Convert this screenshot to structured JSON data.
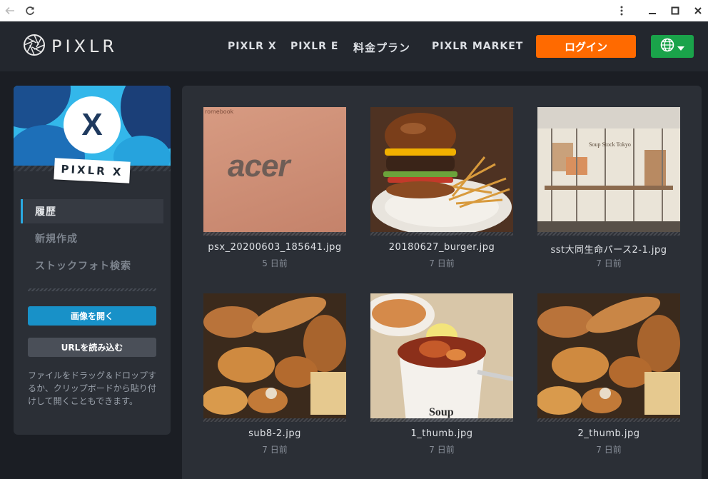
{
  "browser": {
    "back_icon": "arrow-left-icon",
    "reload_icon": "reload-icon",
    "menu_icon": "kebab-menu-icon",
    "minimize_icon": "minimize-icon",
    "maximize_icon": "maximize-icon",
    "close_icon": "close-icon"
  },
  "header": {
    "logo_text": "PIXLR",
    "nav": [
      "PIXLR X",
      "PIXLR E",
      "料金プラン",
      "PIXLR MARKET"
    ],
    "login_label": "ログイン",
    "language_icon": "globe-icon",
    "colors": {
      "login": "#ff6a00",
      "language": "#1aa34a",
      "bar": "#23272e"
    }
  },
  "sidebar": {
    "hero_letter": "X",
    "hero_tag": "PIXLR X",
    "items": [
      {
        "label": "履歴",
        "active": true
      },
      {
        "label": "新規作成",
        "active": false
      },
      {
        "label": "ストックフォト検索",
        "active": false
      }
    ],
    "open_image_label": "画像を開く",
    "load_url_label": "URLを読み込む",
    "help_text": "ファイルをドラッグ＆ドロップするか、クリップボードから貼り付けして開くこともできます。",
    "colors": {
      "accent": "#2aa9e0",
      "primary_button": "#1891c8"
    }
  },
  "gallery": {
    "items": [
      {
        "filename": "psx_20200603_185641.jpg",
        "age": "5 日前",
        "thumb_text": "acer",
        "thumb_caption": "romebook"
      },
      {
        "filename": "20180627_burger.jpg",
        "age": "7 日前"
      },
      {
        "filename": "sst大同生命パース2-1.jpg",
        "age": "7 日前",
        "thumb_text": "Soup Stock Tokyo"
      },
      {
        "filename": "sub8-2.jpg",
        "age": "7 日前"
      },
      {
        "filename": "1_thumb.jpg",
        "age": "7 日前",
        "thumb_text": "Soup"
      },
      {
        "filename": "2_thumb.jpg",
        "age": "7 日前"
      }
    ]
  }
}
